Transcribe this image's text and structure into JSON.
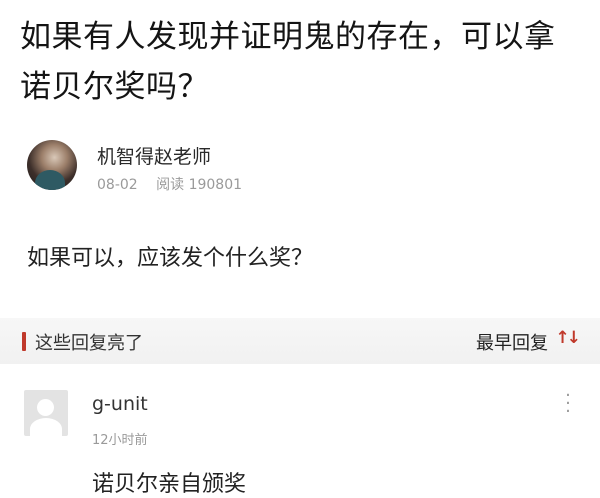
{
  "question": {
    "title": "如果有人发现并证明鬼的存在，可以拿诺贝尔奖吗？",
    "body": "如果可以，应该发个什么奖？"
  },
  "author": {
    "name": "机智得赵老师",
    "date": "08-02",
    "reads": "阅读 190801"
  },
  "replies_section": {
    "title": "这些回复亮了",
    "sort_label": "最早回复",
    "sort_icon": "sort-arrows-icon",
    "accent_color": "#c0392b"
  },
  "replies": [
    {
      "user": "g-unit",
      "time": "12小时前",
      "text": "诺贝尔亲自颁奖"
    }
  ]
}
